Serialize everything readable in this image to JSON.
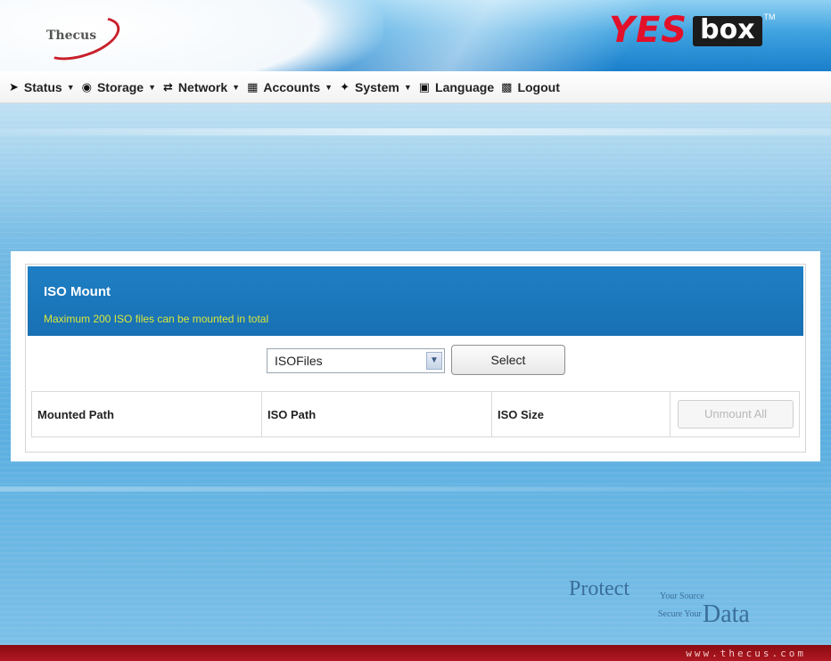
{
  "brand": {
    "thecus_logo_text": "Thecus",
    "product_logo_yes": "YES",
    "product_logo_box": "box",
    "trademark": "TM"
  },
  "menu": {
    "items": [
      {
        "label": "Status",
        "icon": "status-icon",
        "has_caret": true
      },
      {
        "label": "Storage",
        "icon": "storage-icon",
        "has_caret": true
      },
      {
        "label": "Network",
        "icon": "network-icon",
        "has_caret": true
      },
      {
        "label": "Accounts",
        "icon": "accounts-icon",
        "has_caret": true
      },
      {
        "label": "System",
        "icon": "system-icon",
        "has_caret": true
      },
      {
        "label": "Language",
        "icon": "language-icon",
        "has_caret": false
      },
      {
        "label": "Logout",
        "icon": "logout-icon",
        "has_caret": false
      }
    ]
  },
  "panel": {
    "title": "ISO Mount",
    "subtitle": "Maximum 200 ISO files can be mounted in total",
    "select": {
      "value": "ISOFiles",
      "button_label": "Select"
    },
    "table": {
      "columns": [
        "Mounted Path",
        "ISO Path",
        "ISO Size"
      ],
      "unmount_all_label": "Unmount All"
    }
  },
  "footer": {
    "protect_word": "Protect",
    "your_source": "Your Source",
    "secure_your": "Secure Your",
    "data_word": "Data",
    "url": "www.thecus.com"
  },
  "colors": {
    "panel_header": "#1f7fc4",
    "subtitle_text": "#d7e83c",
    "footer_bar": "#9c111a",
    "logo_red": "#e3102a"
  }
}
